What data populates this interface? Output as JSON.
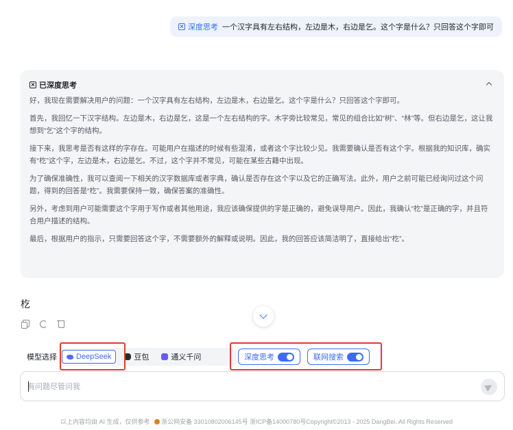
{
  "user_message": {
    "tag": "深度思考",
    "text": "一个汉字具有左右结构，左边是木，右边是乞。这个字是什么？只回答这个字即可"
  },
  "thinking": {
    "title": "已深度思考",
    "paragraphs": [
      "好，我现在需要解决用户的问题：一个汉字具有左右结构，左边是木，右边是乞。这个字是什么？只回答这个字即可。",
      "首先，我回忆一下汉字结构。左边是木，右边是乞，这是一个左右结构的字。木字旁比较常见，常见的组合比如“树”、“林”等。但右边是乞，这让我想到“乞”这个字的结构。",
      "接下来，我思考是否有这样的字存在。可能用户在描述的时候有些混淆，或者这个字比较少见。我需要确认是否有这个字。根据我的知识库，确实有“杚”这个字，左边是木，右边是乞。不过，这个字并不常见，可能在某些古籍中出现。",
      "为了确保准确性，我可以查阅一下相关的汉字数据库或者字典，确认是否存在这个字以及它的正确写法。此外，用户之前可能已经询问过这个问题，得到的回答是“杚”。我需要保持一致，确保答案的准确性。",
      "另外，考虑到用户可能需要这个字用于写作或者其他用途，我应该确保提供的字是正确的，避免误导用户。因此，我确认“杚”是正确的字，并且符合用户描述的结构。",
      "最后，根据用户的指示，只需要回答这个字，不需要额外的解释或说明。因此，我的回答应该简洁明了，直接给出“杚”。"
    ]
  },
  "answer": "杚",
  "model_select": {
    "label": "模型选择",
    "models": [
      {
        "name": "DeepSeek",
        "icon": "whale-icon",
        "active": true
      },
      {
        "name": "豆包",
        "icon": "doubao-icon",
        "active": false
      },
      {
        "name": "通义千问",
        "icon": "qwen-icon",
        "active": false
      }
    ]
  },
  "toggles": {
    "deep_think": "深度思考",
    "web_search": "联网搜索"
  },
  "input": {
    "placeholder": "有问题尽管问我"
  },
  "footer": {
    "text_left": "以上内容均由 AI 生成，仅供参考",
    "text_right": "浙公网安备 33010802006145号 浙ICP备14000780号Copyright©2013 - 2025 DangBei. All Rights Reserved"
  },
  "colors": {
    "accent": "#3b6cf6",
    "highlight": "#e03a2f"
  }
}
